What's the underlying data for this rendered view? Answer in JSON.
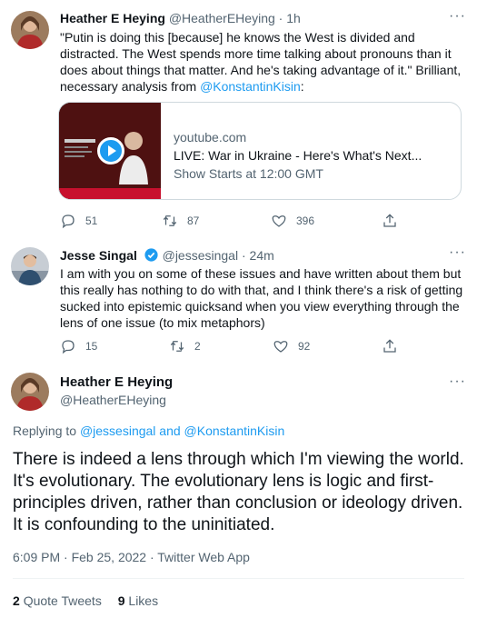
{
  "tweet1": {
    "name": "Heather E Heying",
    "handle": "@HeatherEHeying",
    "time": "1h",
    "text_prefix": "\"Putin is doing this [because] he knows the West is divided and distracted. The West spends more time talking about pronouns than it does about things that matter. And he's taking advantage of it.\" Brilliant, necessary analysis from ",
    "mention": "@KonstantinKisin",
    "text_suffix": ":",
    "card": {
      "domain": "youtube.com",
      "title": "LIVE: War in Ukraine - Here's What's Next...",
      "description": "Show Starts at 12:00 GMT"
    },
    "replies": "51",
    "retweets": "87",
    "likes": "396"
  },
  "tweet2": {
    "name": "Jesse Singal",
    "handle": "@jessesingal",
    "time": "24m",
    "text": "I am with you on some of these issues and have written about them but this really has nothing to do with that, and I think there's a risk of getting sucked into epistemic quicksand when you view everything through the lens of one issue (to mix metaphors)",
    "replies": "15",
    "retweets": "2",
    "likes": "92"
  },
  "main_tweet": {
    "name": "Heather E Heying",
    "handle": "@HeatherEHeying",
    "replying_label": "Replying to ",
    "replying_to": "@jessesingal and @KonstantinKisin",
    "text": "There is indeed a lens through which I'm viewing the world. It's evolutionary. The evolutionary lens is logic and first-principles driven, rather than conclusion or ideology driven. It is confounding to the uninitiated.",
    "timestamp": "6:09 PM · Feb 25, 2022 · Twitter Web App",
    "quote_count": "2",
    "quote_label": "Quote Tweets",
    "like_count": "9",
    "like_label": "Likes"
  },
  "colors": {
    "accent": "#1d9bf0",
    "text": "#0f1419",
    "muted": "#536471",
    "divider": "#eff3f4"
  },
  "icons": [
    "more-icon",
    "reply-icon",
    "retweet-icon",
    "like-icon",
    "share-icon",
    "verified-icon",
    "play-icon"
  ]
}
